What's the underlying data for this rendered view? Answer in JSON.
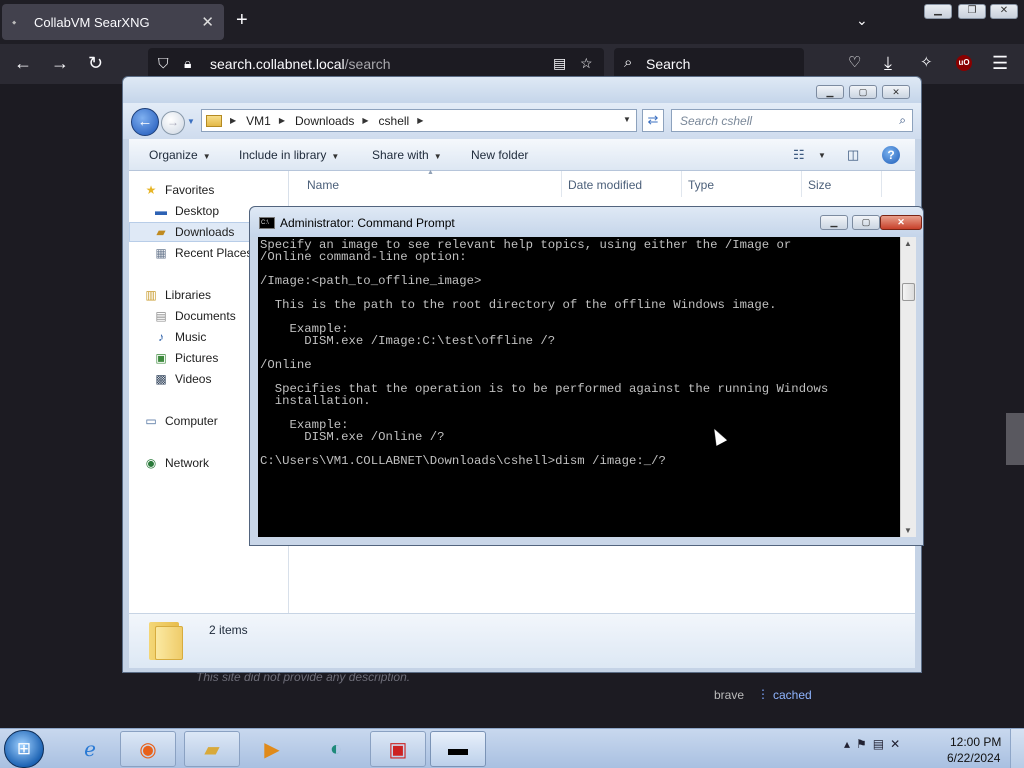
{
  "browser": {
    "tab_title": "CollabVM SearXNG",
    "url_host": "search.collabnet.local",
    "url_path": "/search",
    "search_placeholder": "Search",
    "ublock_label": "uO"
  },
  "page": {
    "description": "This site did not provide any description.",
    "engine": "brave",
    "separator": "⋮",
    "cached_link": "cached"
  },
  "explorer": {
    "breadcrumb": [
      "VM1",
      "Downloads",
      "cshell"
    ],
    "search_placeholder": "Search cshell",
    "toolbar": {
      "organize": "Organize",
      "include_in_library": "Include in library",
      "share_with": "Share with",
      "new_folder": "New folder"
    },
    "nav": {
      "favorites": "Favorites",
      "desktop": "Desktop",
      "downloads": "Downloads",
      "recent_places": "Recent Places",
      "libraries": "Libraries",
      "documents": "Documents",
      "music": "Music",
      "pictures": "Pictures",
      "videos": "Videos",
      "computer": "Computer",
      "network": "Network"
    },
    "columns": {
      "name": "Name",
      "date_modified": "Date modified",
      "type": "Type",
      "size": "Size"
    },
    "details": {
      "item_count": "2 items"
    }
  },
  "cmd": {
    "title": "Administrator: Command Prompt",
    "output": "Specify an image to see relevant help topics, using either the /Image or\n/Online command-line option:\n\n/Image:<path_to_offline_image>\n\n  This is the path to the root directory of the offline Windows image.\n\n    Example:\n      DISM.exe /Image:C:\\test\\offline /?\n\n/Online\n\n  Specifies that the operation is to be performed against the running Windows\n  installation.\n\n    Example:\n      DISM.exe /Online /?\n\nC:\\Users\\VM1.COLLABNET\\Downloads\\cshell>dism /image:_/?"
  },
  "taskbar": {
    "time": "12:00 PM",
    "date": "6/22/2024"
  },
  "colors": {
    "browser_dark": "#2b2a33",
    "console_bg": "#000000",
    "console_fg": "#c0c0c0",
    "link": "#8fb5ff"
  }
}
